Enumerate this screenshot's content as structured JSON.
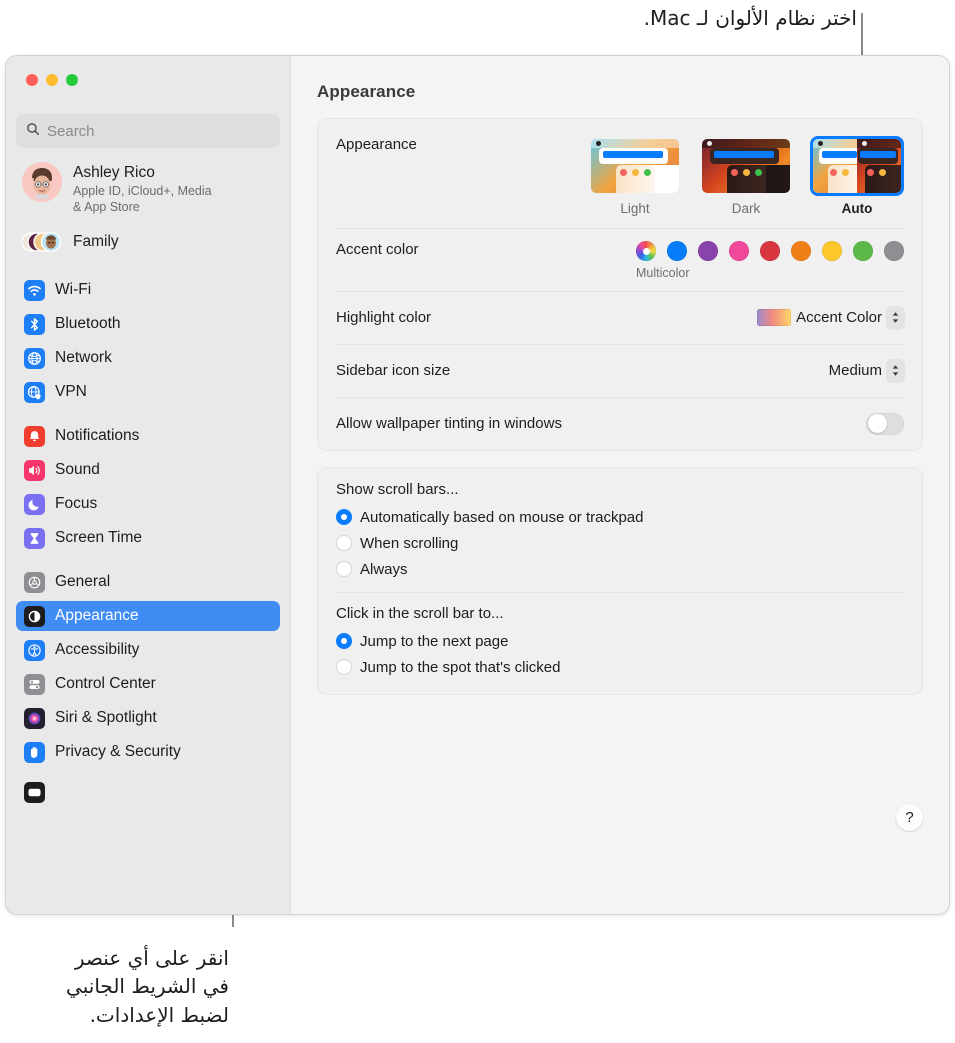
{
  "callouts": {
    "top": "اختر نظام الألوان لـ Mac.",
    "bottom": "انقر على أي عنصر\nفي الشريط الجانبي\nلضبط الإعدادات."
  },
  "window": {
    "title": "Appearance"
  },
  "sidebar": {
    "search": {
      "placeholder": "Search",
      "icon": "search-icon"
    },
    "account": {
      "name": "Ashley Rico",
      "subtitle": "Apple ID, iCloud+, Media\n& App Store"
    },
    "family": {
      "label": "Family"
    },
    "groups": [
      {
        "items": [
          {
            "label": "Wi-Fi",
            "icon": "wifi-icon",
            "color": "#1e7ef5"
          },
          {
            "label": "Bluetooth",
            "icon": "bluetooth-icon",
            "color": "#1e7ef5"
          },
          {
            "label": "Network",
            "icon": "globe-icon",
            "color": "#1e7ef5"
          },
          {
            "label": "VPN",
            "icon": "vpn-globe-icon",
            "color": "#1e7ef5"
          }
        ]
      },
      {
        "items": [
          {
            "label": "Notifications",
            "icon": "bell-icon",
            "color": "#f03d2e"
          },
          {
            "label": "Sound",
            "icon": "speaker-icon",
            "color": "#f6366a"
          },
          {
            "label": "Focus",
            "icon": "moon-icon",
            "color": "#7a6ff0"
          },
          {
            "label": "Screen Time",
            "icon": "hourglass-icon",
            "color": "#7a6ff0"
          }
        ]
      },
      {
        "items": [
          {
            "label": "General",
            "icon": "gear-icon",
            "color": "#8e8e93"
          },
          {
            "label": "Appearance",
            "icon": "appearance-icon",
            "color": "#1d1d1f",
            "selected": true
          },
          {
            "label": "Accessibility",
            "icon": "accessibility-icon",
            "color": "#1e7ef5"
          },
          {
            "label": "Control Center",
            "icon": "control-center-icon",
            "color": "#8e8e93"
          },
          {
            "label": "Siri & Spotlight",
            "icon": "siri-icon",
            "color": "#2a2a3a"
          },
          {
            "label": "Privacy & Security",
            "icon": "hand-icon",
            "color": "#1e7ef5"
          }
        ]
      }
    ]
  },
  "main": {
    "appearance": {
      "label": "Appearance",
      "options": [
        {
          "label": "Light",
          "selected": false
        },
        {
          "label": "Dark",
          "selected": false
        },
        {
          "label": "Auto",
          "selected": true
        }
      ]
    },
    "accent": {
      "label": "Accent color",
      "caption": "Multicolor",
      "swatches": [
        {
          "name": "multicolor",
          "color": "multicolor",
          "selected": true
        },
        {
          "name": "blue",
          "color": "#067cf8"
        },
        {
          "name": "purple",
          "color": "#8944ab"
        },
        {
          "name": "pink",
          "color": "#f2489c"
        },
        {
          "name": "red",
          "color": "#d93640"
        },
        {
          "name": "orange",
          "color": "#f08016"
        },
        {
          "name": "yellow",
          "color": "#fdc72c"
        },
        {
          "name": "green",
          "color": "#5bb94a"
        },
        {
          "name": "graphite",
          "color": "#8e8e93"
        }
      ]
    },
    "highlight": {
      "label": "Highlight color",
      "value": "Accent Color"
    },
    "sidebar_icon_size": {
      "label": "Sidebar icon size",
      "value": "Medium"
    },
    "wallpaper_tinting": {
      "label": "Allow wallpaper tinting in windows",
      "enabled": false
    },
    "scroll_bars": {
      "heading": "Show scroll bars...",
      "options": [
        {
          "label": "Automatically based on mouse or trackpad",
          "selected": true
        },
        {
          "label": "When scrolling",
          "selected": false
        },
        {
          "label": "Always",
          "selected": false
        }
      ]
    },
    "scroll_click": {
      "heading": "Click in the scroll bar to...",
      "options": [
        {
          "label": "Jump to the next page",
          "selected": true
        },
        {
          "label": "Jump to the spot that's clicked",
          "selected": false
        }
      ]
    },
    "help": {
      "label": "?"
    }
  }
}
